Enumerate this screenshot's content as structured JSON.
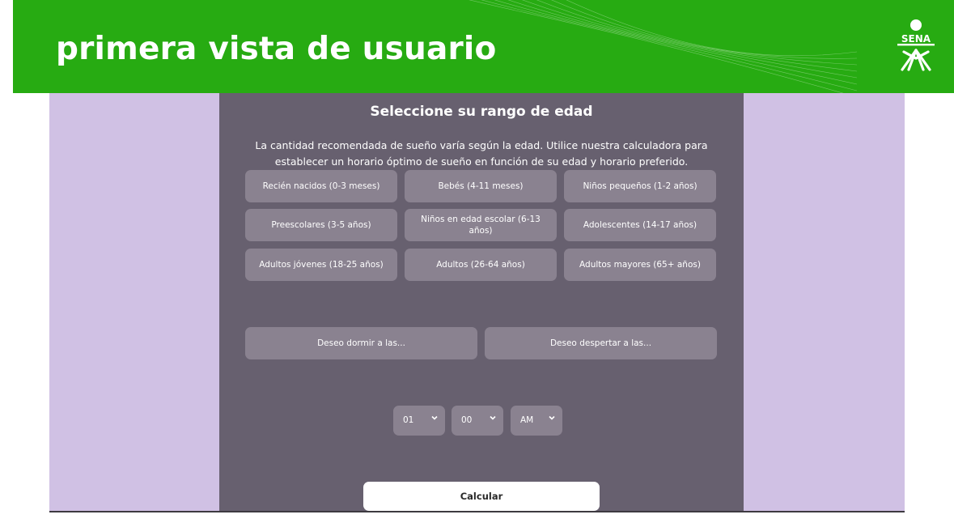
{
  "slide": {
    "title": "primera vista de usuario",
    "logo_text": "SENA",
    "header_color": "#27ab12"
  },
  "app": {
    "background_color": "#d0c1e4",
    "panel_color": "#67606f",
    "button_color": "#8a8290",
    "title": "Seleccione su rango de edad",
    "description": "La cantidad recomendada de sueño varía según la edad. Utilice nuestra calculadora para establecer un horario óptimo de sueño en función de su edad y horario preferido.",
    "age_ranges": [
      "Recién nacidos (0-3 meses)",
      "Bebés (4-11 meses)",
      "Niños pequeños (1-2 años)",
      "Preescolares (3-5 años)",
      "Niños en edad escolar (6-13 años)",
      "Adolescentes (14-17 años)",
      "Adultos jóvenes (18-25 años)",
      "Adultos (26-64 años)",
      "Adultos mayores (65+ años)"
    ],
    "modes": {
      "sleep": "Deseo dormir a las...",
      "wake": "Deseo despertar a las..."
    },
    "time": {
      "hour": "01",
      "minute": "00",
      "period": "AM"
    },
    "calculate_label": "Calcular"
  }
}
